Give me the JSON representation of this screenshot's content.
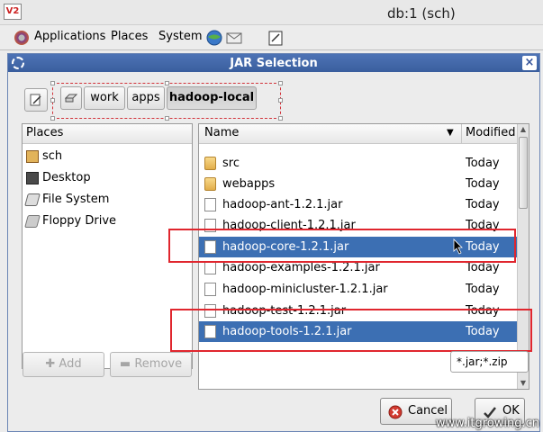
{
  "window": {
    "title": "db:1 (sch)",
    "logo": "V2"
  },
  "panel": {
    "menus": [
      "Applications",
      "Places",
      "System"
    ]
  },
  "dialog": {
    "title": "JAR Selection",
    "close_glyph": "×"
  },
  "pathbar": {
    "buttons": [
      {
        "label": ""
      },
      {
        "label": "work"
      },
      {
        "label": "apps"
      },
      {
        "label": "hadoop-local",
        "active": true
      }
    ]
  },
  "places": {
    "header": "Places",
    "items": [
      {
        "label": "sch",
        "icon": "home-icon"
      },
      {
        "label": "Desktop",
        "icon": "desktop-icon"
      },
      {
        "label": "File System",
        "icon": "harddisk-icon"
      },
      {
        "label": "Floppy Drive",
        "icon": "floppy-icon"
      }
    ]
  },
  "files": {
    "columns": {
      "name": "Name",
      "modified": "Modified"
    },
    "rows": [
      {
        "name": "src",
        "date": "Today",
        "type": "folder"
      },
      {
        "name": "webapps",
        "date": "Today",
        "type": "folder"
      },
      {
        "name": "hadoop-ant-1.2.1.jar",
        "date": "Today",
        "type": "file"
      },
      {
        "name": "hadoop-client-1.2.1.jar",
        "date": "Today",
        "type": "file"
      },
      {
        "name": "hadoop-core-1.2.1.jar",
        "date": "Today",
        "type": "file",
        "selected": true
      },
      {
        "name": "hadoop-examples-1.2.1.jar",
        "date": "Today",
        "type": "file"
      },
      {
        "name": "hadoop-minicluster-1.2.1.jar",
        "date": "Today",
        "type": "file"
      },
      {
        "name": "hadoop-test-1.2.1.jar",
        "date": "Today",
        "type": "file"
      },
      {
        "name": "hadoop-tools-1.2.1.jar",
        "date": "Today",
        "type": "file",
        "selected": true
      }
    ]
  },
  "buttons": {
    "add": "Add",
    "remove": "Remove",
    "filter": "*.jar;*.zip",
    "cancel": "Cancel",
    "ok": "OK"
  },
  "watermark": "www.itgrowing.cn",
  "colors": {
    "selection": "#3c6fb3",
    "titlebar": "#4d73b5",
    "annotation": "#e0262e"
  }
}
